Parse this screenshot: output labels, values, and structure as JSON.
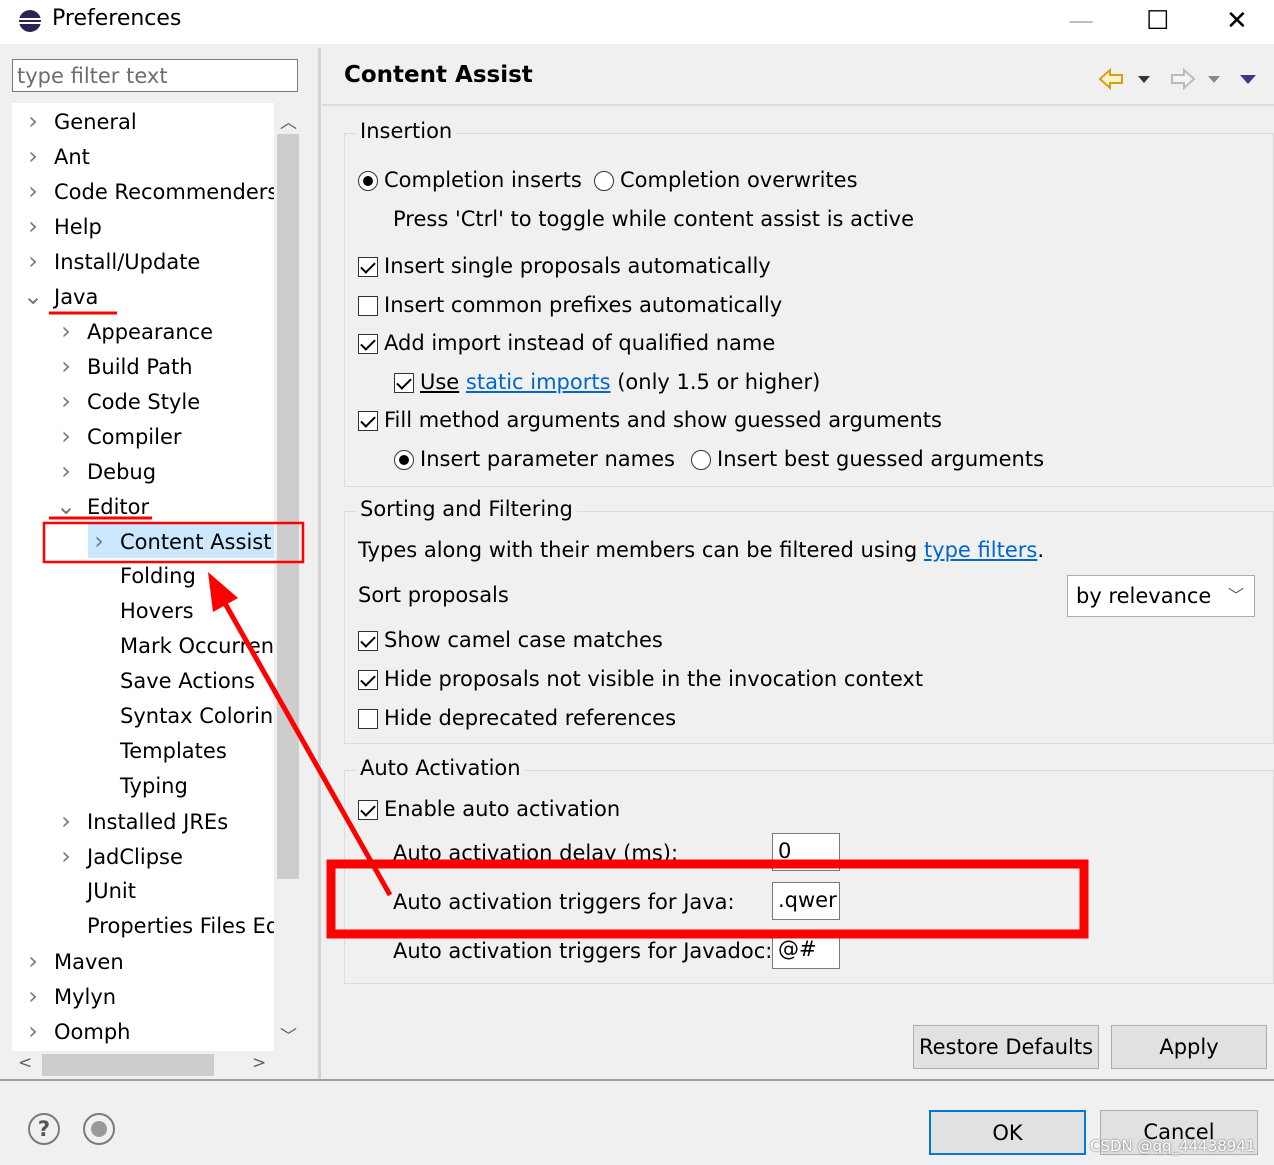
{
  "window": {
    "title": "Preferences",
    "controls": {
      "minimize": "—",
      "maximize": "☐",
      "close": "✕"
    }
  },
  "filter": {
    "placeholder": "type filter text"
  },
  "tree": {
    "items": [
      {
        "label": "General",
        "state": "collapsed"
      },
      {
        "label": "Ant",
        "state": "collapsed"
      },
      {
        "label": "Code Recommenders",
        "state": "collapsed"
      },
      {
        "label": "Help",
        "state": "collapsed"
      },
      {
        "label": "Install/Update",
        "state": "collapsed"
      },
      {
        "label": "Java",
        "state": "expanded"
      },
      {
        "label": "Appearance",
        "state": "collapsed"
      },
      {
        "label": "Build Path",
        "state": "collapsed"
      },
      {
        "label": "Code Style",
        "state": "collapsed"
      },
      {
        "label": "Compiler",
        "state": "collapsed"
      },
      {
        "label": "Debug",
        "state": "collapsed"
      },
      {
        "label": "Editor",
        "state": "expanded"
      },
      {
        "label": "Content Assist",
        "state": "collapsed",
        "selected": true
      },
      {
        "label": "Folding",
        "state": "leaf"
      },
      {
        "label": "Hovers",
        "state": "leaf"
      },
      {
        "label": "Mark Occurren",
        "state": "leaf"
      },
      {
        "label": "Save Actions",
        "state": "leaf"
      },
      {
        "label": "Syntax Coloring",
        "state": "leaf"
      },
      {
        "label": "Templates",
        "state": "leaf"
      },
      {
        "label": "Typing",
        "state": "leaf"
      },
      {
        "label": "Installed JREs",
        "state": "collapsed"
      },
      {
        "label": "JadClipse",
        "state": "collapsed"
      },
      {
        "label": "JUnit",
        "state": "leaf"
      },
      {
        "label": "Properties Files Ed",
        "state": "leaf"
      },
      {
        "label": "Maven",
        "state": "collapsed"
      },
      {
        "label": "Mylyn",
        "state": "collapsed"
      },
      {
        "label": "Oomph",
        "state": "collapsed"
      }
    ]
  },
  "page": {
    "title": "Content Assist",
    "insertion": {
      "legend": "Insertion",
      "radio_inserts": "Completion inserts",
      "radio_overwrites": "Completion overwrites",
      "hint": "Press 'Ctrl' to toggle while content assist is active",
      "insert_single": "Insert single proposals automatically",
      "insert_prefixes": "Insert common prefixes automatically",
      "add_import": "Add import instead of qualified name",
      "use_prefix": "Use",
      "use_link": "static imports",
      "use_suffix": "(only 1.5 or higher)",
      "fill_method": "Fill method arguments and show guessed arguments",
      "radio_param_names": "Insert parameter names",
      "radio_best_guessed": "Insert best guessed arguments"
    },
    "sorting": {
      "legend": "Sorting and Filtering",
      "types_text": "Types along with their members can be filtered using",
      "types_link": "type filters",
      "types_end": ".",
      "sort_label": "Sort proposals",
      "sort_value": "by relevance",
      "camel_case": "Show camel case matches",
      "hide_not_visible": "Hide proposals not visible in the invocation context",
      "hide_deprecated": "Hide deprecated references"
    },
    "auto": {
      "legend": "Auto Activation",
      "enable": "Enable auto activation",
      "delay_label": "Auto activation delay (ms):",
      "delay_value": "0",
      "java_label": "Auto activation triggers for Java:",
      "java_value": ".qwer",
      "javadoc_label": "Auto activation triggers for Javadoc:",
      "javadoc_value": "@#"
    },
    "buttons": {
      "restore": "Restore Defaults",
      "apply": "Apply"
    }
  },
  "footer": {
    "ok": "OK",
    "cancel": "Cancel",
    "help": "?"
  },
  "watermark": "CSDN @qq_44438941",
  "colors": {
    "annotation_red": "#ff0000",
    "link": "#0066cc",
    "selection": "#cce8ff"
  }
}
